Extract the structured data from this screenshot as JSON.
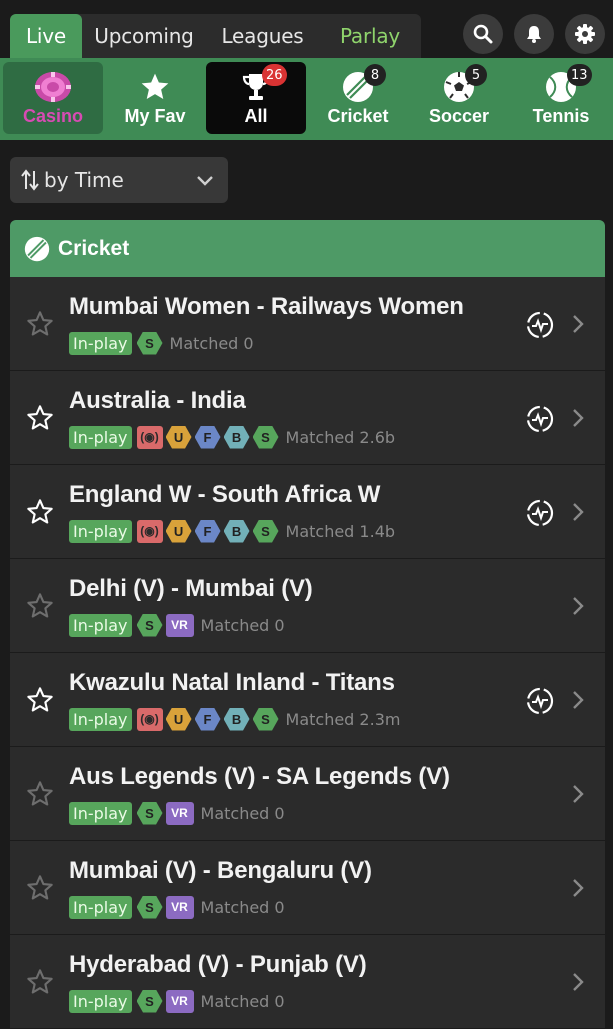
{
  "tabs": [
    {
      "label": "Live"
    },
    {
      "label": "Upcoming"
    },
    {
      "label": "Leagues"
    },
    {
      "label": "Parlay"
    }
  ],
  "header_icons": [
    "search-icon",
    "bell-icon",
    "gear-icon"
  ],
  "sports": [
    {
      "label": "Casino",
      "count": ""
    },
    {
      "label": "My Fav",
      "count": ""
    },
    {
      "label": "All",
      "count": "26"
    },
    {
      "label": "Cricket",
      "count": "8"
    },
    {
      "label": "Soccer",
      "count": "5"
    },
    {
      "label": "Tennis",
      "count": "13"
    }
  ],
  "sort": {
    "label": "by Time"
  },
  "section": {
    "title": "Cricket"
  },
  "matches": [
    {
      "name": "Mumbai Women - Railways Women",
      "status": "In-play",
      "matched": "Matched 0",
      "badges": [
        "S"
      ],
      "starred": false,
      "stats": true
    },
    {
      "name": "Australia - India",
      "status": "In-play",
      "matched": "Matched 2.6b",
      "badges": [
        "live",
        "U",
        "F",
        "B",
        "S"
      ],
      "starred": true,
      "stats": true
    },
    {
      "name": "England W - South Africa W",
      "status": "In-play",
      "matched": "Matched 1.4b",
      "badges": [
        "live",
        "U",
        "F",
        "B",
        "S"
      ],
      "starred": true,
      "stats": true
    },
    {
      "name": "Delhi (V) - Mumbai (V)",
      "status": "In-play",
      "matched": "Matched 0",
      "badges": [
        "S",
        "VR"
      ],
      "starred": false,
      "stats": false
    },
    {
      "name": "Kwazulu Natal Inland - Titans",
      "status": "In-play",
      "matched": "Matched 2.3m",
      "badges": [
        "live",
        "U",
        "F",
        "B",
        "S"
      ],
      "starred": true,
      "stats": true
    },
    {
      "name": "Aus Legends (V) - SA Legends (V)",
      "status": "In-play",
      "matched": "Matched 0",
      "badges": [
        "S",
        "VR"
      ],
      "starred": false,
      "stats": false
    },
    {
      "name": "Mumbai (V) - Bengaluru (V)",
      "status": "In-play",
      "matched": "Matched 0",
      "badges": [
        "S",
        "VR"
      ],
      "starred": false,
      "stats": false
    },
    {
      "name": "Hyderabad (V) - Punjab (V)",
      "status": "In-play",
      "matched": "Matched 0",
      "badges": [
        "S",
        "VR"
      ],
      "starred": false,
      "stats": false
    }
  ],
  "colors": {
    "accent_green": "#4e9a66",
    "parlay_text": "#8fd46c",
    "casino_text": "#d74bb3",
    "count_red": "#d93333"
  }
}
